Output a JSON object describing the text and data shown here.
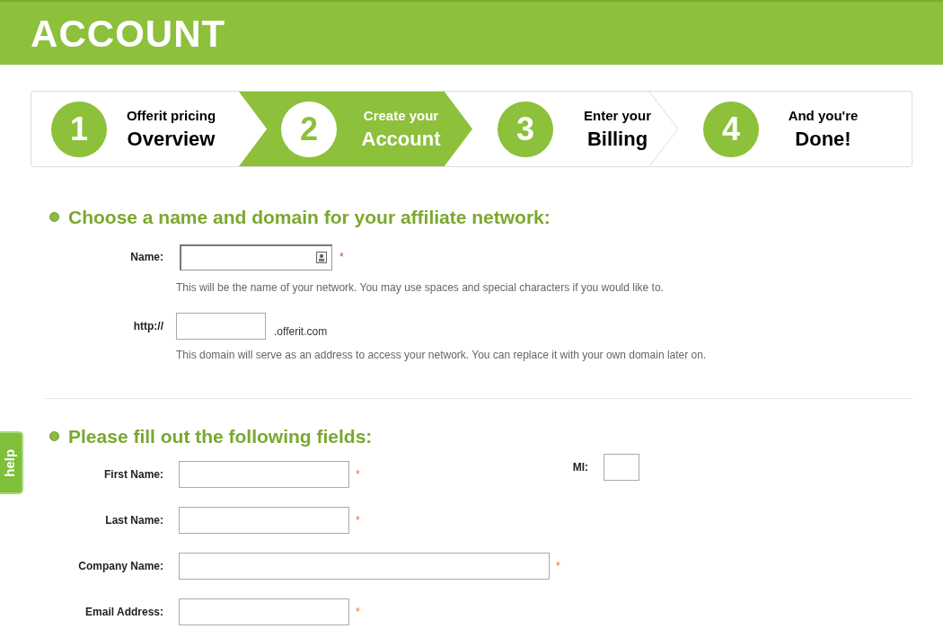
{
  "header": {
    "title": "ACCOUNT"
  },
  "steps": [
    {
      "number": "1",
      "line1": "Offerit pricing",
      "line2": "Overview",
      "selected": false
    },
    {
      "number": "2",
      "line1": "Create your",
      "line2": "Account",
      "selected": true
    },
    {
      "number": "3",
      "line1": "Enter your",
      "line2": "Billing",
      "selected": false
    },
    {
      "number": "4",
      "line1": "And you're",
      "line2": "Done!",
      "selected": false
    }
  ],
  "section1": {
    "heading": "Choose a name and domain for your affiliate network:",
    "name_field": {
      "label": "Name:",
      "required": "*",
      "icon": true,
      "hint": "This will be the name of your network. You may use spaces and special characters if you would like to."
    },
    "domain_field": {
      "label": "http://",
      "suffix": ".offerit.com",
      "hint": "This domain will serve as an address to access your network. You can replace it with your own domain later on."
    }
  },
  "section2": {
    "heading": "Please fill out the following fields:",
    "fields": [
      {
        "label": "First Name:",
        "required": "*",
        "kind": "short"
      },
      {
        "label": "Last Name:",
        "required": "*",
        "kind": "short"
      },
      {
        "label": "Company Name:",
        "required": "*",
        "kind": "long"
      },
      {
        "label": "Email Address:",
        "required": "*",
        "kind": "short"
      }
    ],
    "mi_field": {
      "label": "MI:"
    }
  },
  "help_tab": {
    "label": "help"
  }
}
